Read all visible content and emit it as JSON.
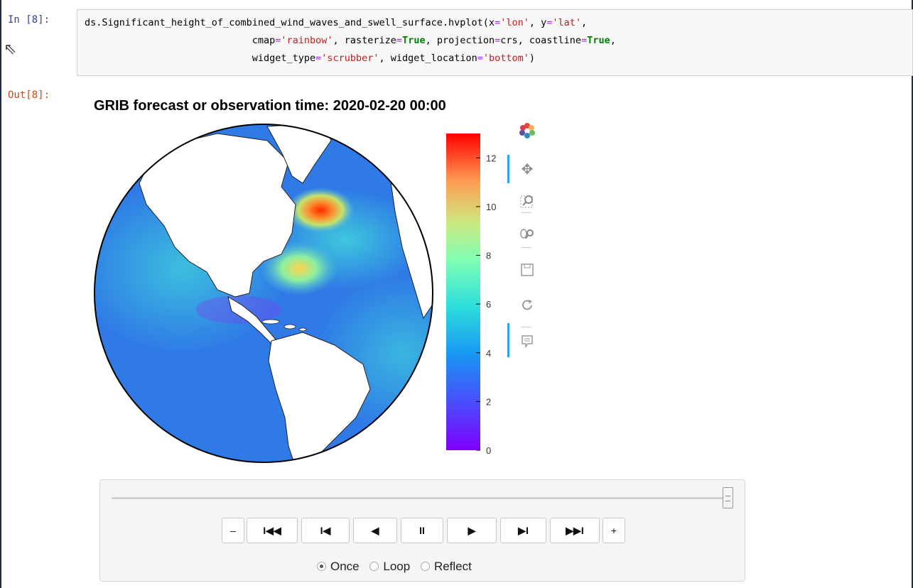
{
  "notebook": {
    "in_prompt": "In [8]:",
    "out_prompt": "Out[8]:",
    "code": {
      "line1_a": "ds.Significant_height_of_combined_wind_waves_and_swell_surface.hvplot(x",
      "line1_b": "=",
      "line1_c": "'lon'",
      "line1_d": ", y",
      "line1_e": "=",
      "line1_f": "'lat'",
      "line1_g": ",",
      "line2_a": "cmap",
      "line2_b": "=",
      "line2_c": "'rainbow'",
      "line2_d": ", rasterize",
      "line2_e": "=",
      "line2_f": "True",
      "line2_g": ", projection",
      "line2_h": "=",
      "line2_i": "crs, coastline",
      "line2_j": "=",
      "line2_k": "True",
      "line2_l": ",",
      "line3_a": "widget_type",
      "line3_b": "=",
      "line3_c": "'scrubber'",
      "line3_d": ", widget_location",
      "line3_e": "=",
      "line3_f": "'bottom'",
      "line3_g": ")"
    }
  },
  "plot": {
    "title": "GRIB forecast or observation time: 2020-02-20 00:00",
    "colormap": "rainbow",
    "colorbar_ticks": [
      "12",
      "10",
      "8",
      "6",
      "4",
      "2",
      "0"
    ],
    "colorbar_values": [
      12,
      10,
      8,
      6,
      4,
      2,
      0
    ],
    "colorbar_range": [
      0,
      13
    ]
  },
  "toolbar": {
    "tools": [
      "bokeh-logo-icon",
      "pan-icon",
      "box-zoom-icon",
      "wheel-zoom-icon",
      "save-icon",
      "reset-icon",
      "hover-icon"
    ]
  },
  "player": {
    "slider_value": 1.0,
    "buttons": [
      "–",
      "I◀◀",
      "I◀",
      "◀",
      "II",
      "▶",
      "▶I",
      "▶▶I",
      "+"
    ],
    "loop_options": [
      "Once",
      "Loop",
      "Reflect"
    ],
    "selected_option": "Once"
  },
  "colors": {
    "accent": "#26aae1",
    "in_prompt": "#303f9f",
    "out_prompt": "#d84315"
  }
}
